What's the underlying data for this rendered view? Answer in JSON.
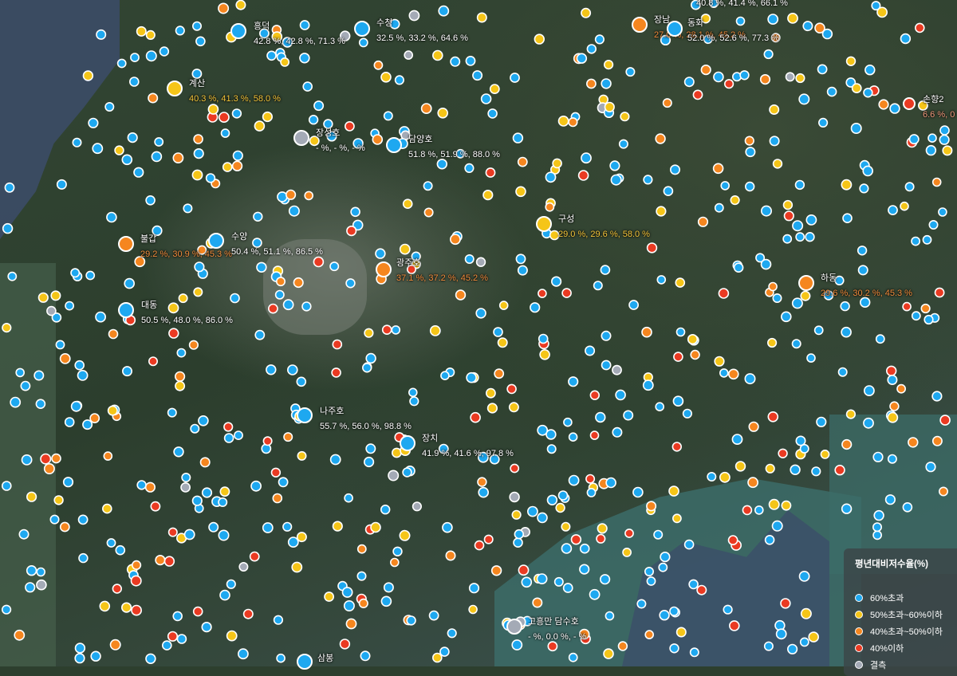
{
  "colors": {
    "over60": "#1ea8f0",
    "from50to60": "#f5c518",
    "from40to50": "#f5861f",
    "under40": "#ea3a22",
    "missing": "#a4aab6",
    "label_white": "#ffffff",
    "label_yellow": "#f3c43a",
    "label_orange": "#f08c3c",
    "label_salmon": "#f09a7c",
    "water_deep": "#3c4c6a",
    "water_sea": "#3c6c68"
  },
  "legend": {
    "title": "평년대비저수율(%)",
    "items": [
      {
        "label": "60%초과",
        "color": "#1ea8f0"
      },
      {
        "label": "50%초과~60%이하",
        "color": "#f5c518"
      },
      {
        "label": "40%초과~50%이하",
        "color": "#f5861f"
      },
      {
        "label": "40%이하",
        "color": "#ea3a22"
      },
      {
        "label": "결측",
        "color": "#a4aab6"
      }
    ]
  },
  "reservoirs": [
    {
      "name": "흥덕",
      "values": "42.8 %, 42.8 %, 71.3 %",
      "category": "over60"
    },
    {
      "name": "수청",
      "values": "32.5 %, 33.2 %, 64.6 %",
      "category": "over60"
    },
    {
      "name": "장남",
      "values": "27.0 %, 28.1 %, 45.2 %",
      "category": "from40to50"
    },
    {
      "name": "동화",
      "values": "52.0 %, 52.6 %, 77.3 %",
      "category": "over60"
    },
    {
      "name": "계산",
      "values": "40.3 %, 41.3 %, 58.0 %",
      "category": "from50to60"
    },
    {
      "name": "장성호",
      "values": "- %, - %, - %",
      "category": "missing"
    },
    {
      "name": "담양호",
      "values": "51.8 %, 51.9 %, 88.0 %",
      "category": "over60"
    },
    {
      "name": "손향2",
      "values": "6.6 %, 0",
      "category": "under40"
    },
    {
      "name": "불갑",
      "values": "29.2 %, 30.9 %, 45.3 %",
      "category": "from40to50"
    },
    {
      "name": "수양",
      "values": "50.4 %, 51.1 %, 86.5 %",
      "category": "over60"
    },
    {
      "name": "구성",
      "values": "29.0 %, 29.6 %, 58.0 %",
      "category": "from50to60"
    },
    {
      "name": "광주호",
      "values": "37.1 %, 37.2 %, 45.2 %",
      "category": "from40to50"
    },
    {
      "name": "하동",
      "values": "29.6 %, 30.2 %, 45.3 %",
      "category": "from40to50"
    },
    {
      "name": "대동",
      "values": "50.5 %, 48.0 %, 86.0 %",
      "category": "over60"
    },
    {
      "name": "나주호",
      "values": "55.7 %, 56.0 %, 98.8 %",
      "category": "over60"
    },
    {
      "name": "장치",
      "values": "41.9 %, 41.6 %, 97.8 %",
      "category": "over60"
    },
    {
      "name": "고흥만 담수호",
      "values": "- %, 0.0 %, - %",
      "category": "missing"
    },
    {
      "name": "삼봉",
      "values": "",
      "category": "over60"
    },
    {
      "name": "",
      "values": "40.8 %, 41.4 %, 66.1 %",
      "category": "over60"
    }
  ]
}
